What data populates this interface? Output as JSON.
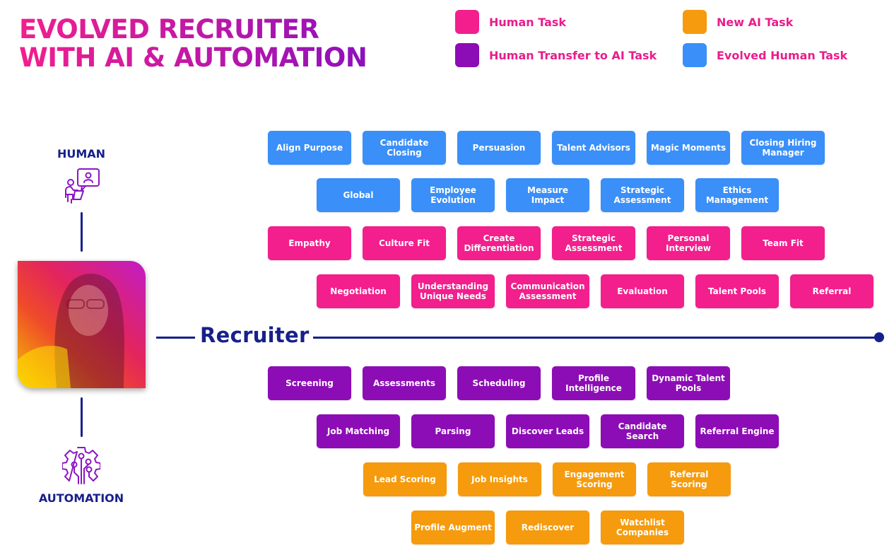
{
  "title": {
    "line1": "EVOLVED RECRUITER",
    "line2": "WITH AI & AUTOMATION"
  },
  "colors": {
    "human_task": "#f21f8d",
    "human_transfer_to_ai": "#8c0db5",
    "new_ai_task": "#f59b0d",
    "evolved_human_task": "#3a8ff8",
    "navy": "#17208a"
  },
  "legend": [
    {
      "label": "Human Task",
      "key": "human_task"
    },
    {
      "label": "Human Transfer to AI Task",
      "key": "human_transfer_to_ai"
    },
    {
      "label": "New AI Task",
      "key": "new_ai_task"
    },
    {
      "label": "Evolved Human Task",
      "key": "evolved_human_task"
    }
  ],
  "side": {
    "human_label": "HUMAN",
    "human_icon": "person-chat-icon",
    "automation_label": "AUTOMATION",
    "automation_icon": "gear-circuit-icon",
    "center_label": "Recruiter",
    "photo": "recruiter-photo"
  },
  "rows": [
    {
      "type": "evolved_human_task",
      "items": [
        "Align Purpose",
        "Candidate\nClosing",
        "Persuasion",
        "Talent Advisors",
        "Magic Moments",
        "Closing Hiring\nManager"
      ]
    },
    {
      "type": "evolved_human_task",
      "items": [
        "Global",
        "Employee\nEvolution",
        "Measure\nImpact",
        "Strategic\nAssessment",
        "Ethics\nManagement"
      ]
    },
    {
      "type": "human_task",
      "items": [
        "Empathy",
        "Culture Fit",
        "Create\nDifferentiation",
        "Strategic\nAssessment",
        "Personal\nInterview",
        "Team Fit"
      ]
    },
    {
      "type": "human_task",
      "items": [
        "Negotiation",
        "Understanding\nUnique Needs",
        "Communication\nAssessment",
        "Evaluation",
        "Talent Pools",
        "Referral"
      ]
    },
    {
      "type": "human_transfer_to_ai",
      "items": [
        "Screening",
        "Assessments",
        "Scheduling",
        "Profile\nIntelligence",
        "Dynamic Talent\nPools"
      ]
    },
    {
      "type": "human_transfer_to_ai",
      "items": [
        "Job Matching",
        "Parsing",
        "Discover Leads",
        "Candidate\nSearch",
        "Referral Engine"
      ]
    },
    {
      "type": "new_ai_task",
      "items": [
        "Lead Scoring",
        "Job Insights",
        "Engagement\nScoring",
        "Referral Scoring"
      ]
    },
    {
      "type": "new_ai_task",
      "items": [
        "Profile Augment",
        "Rediscover",
        "Watchlist\nCompanies"
      ]
    }
  ]
}
